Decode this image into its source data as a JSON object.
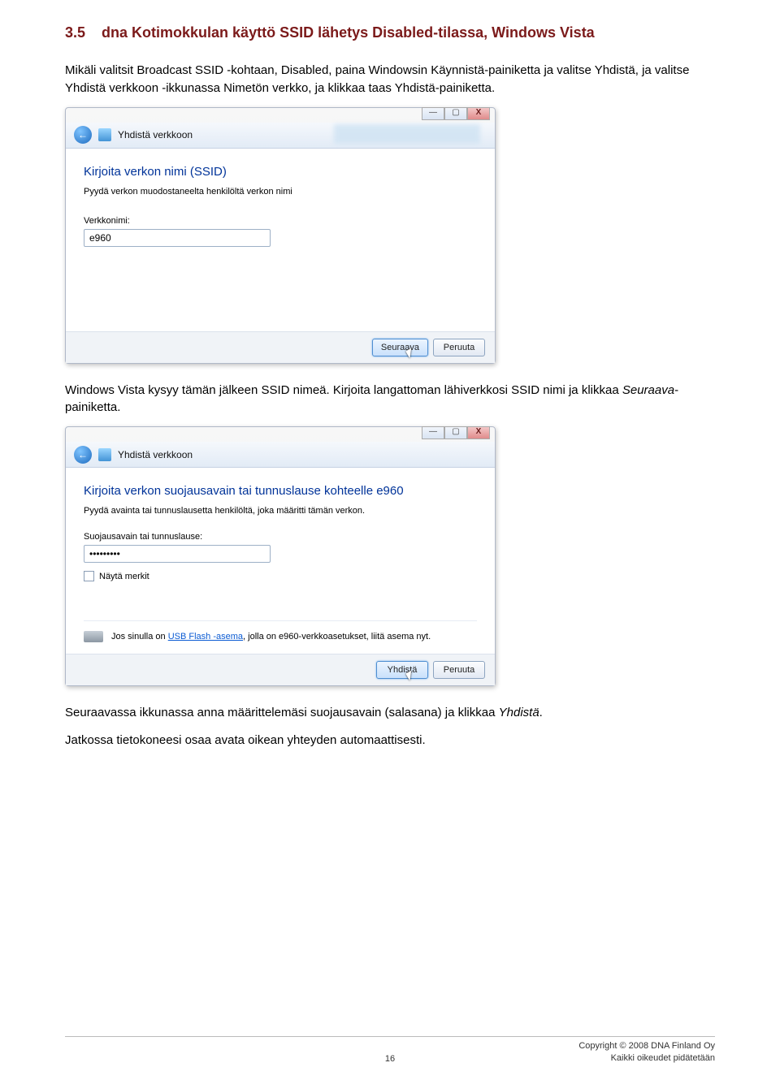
{
  "section": {
    "number": "3.5",
    "title": "dna Kotimokkulan käyttö SSID lähetys Disabled-tilassa, Windows Vista"
  },
  "para1_plain": "Mikäli valitsit Broadcast SSID -kohtaan, Disabled, paina Windowsin Käynnistä-painiketta ja valitse Yhdistä, ja valitse Yhdistä verkkoon -ikkunassa Nimetön verkko, ja klikkaa taas Yhdistä-painiketta.",
  "para2_a": "Windows Vista kysyy tämän jälkeen SSID nimeä. Kirjoita langattoman lähiverkkosi SSID nimi ja klikkaa ",
  "para2_em": "Seuraava",
  "para2_b": "-painiketta.",
  "para3_a": "Seuraavassa ikkunassa anna määrittelemäsi suojausavain (salasana) ja klikkaa ",
  "para3_em": "Yhdistä",
  "para3_b": ".",
  "para4": "Jatkossa tietokoneesi osaa avata oikean yhteyden automaattisesti.",
  "dialog1": {
    "wizard_title": "Yhdistä verkkoon",
    "heading": "Kirjoita verkon nimi (SSID)",
    "sub": "Pyydä verkon muodostaneelta henkilöltä verkon nimi",
    "label": "Verkkonimi:",
    "value": "e960",
    "btn_primary": "Seuraava",
    "btn_cancel": "Peruuta"
  },
  "dialog2": {
    "wizard_title": "Yhdistä verkkoon",
    "heading": "Kirjoita verkon suojausavain tai tunnuslause kohteelle e960",
    "sub": "Pyydä avainta tai tunnuslausetta henkilöltä, joka määritti tämän verkon.",
    "label": "Suojausavain tai tunnuslause:",
    "value": "•••••••••",
    "chk_label": "Näytä merkit",
    "usb_a": "Jos sinulla on ",
    "usb_link": "USB Flash -asema",
    "usb_b": ", jolla on e960-verkkoasetukset, liitä asema nyt.",
    "btn_primary": "Yhdistä",
    "btn_cancel": "Peruuta"
  },
  "footer": {
    "page": "16",
    "copyright": "Copyright © 2008 DNA Finland Oy",
    "rights": "Kaikki oikeudet pidätetään"
  },
  "winctl": {
    "min": "—",
    "max": "▢",
    "close": "X"
  }
}
